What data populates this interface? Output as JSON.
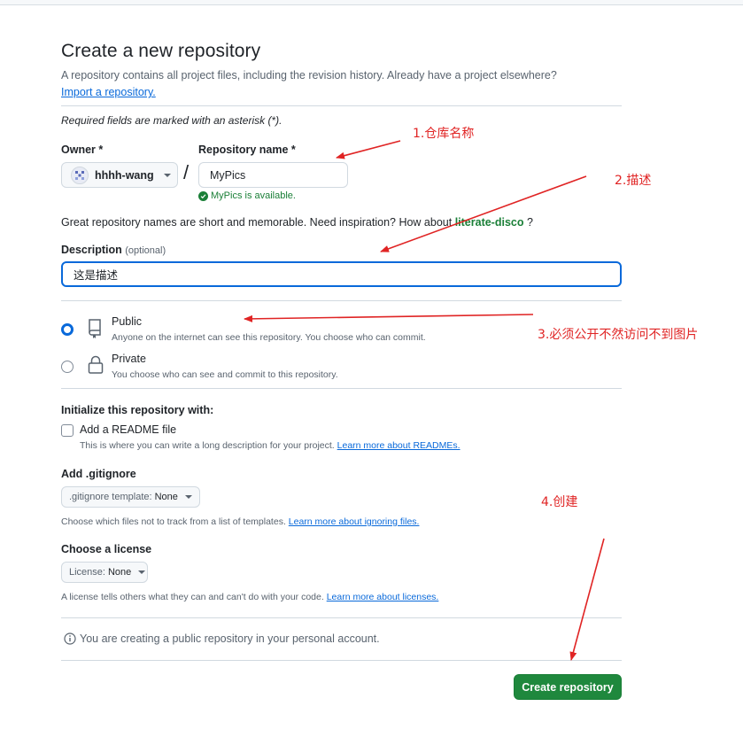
{
  "page": {
    "title": "Create a new repository",
    "subtitle": "A repository contains all project files, including the revision history. Already have a project elsewhere?",
    "import_link": "Import a repository.",
    "required_note": "Required fields are marked with an asterisk (*)."
  },
  "owner": {
    "label": "Owner *",
    "value": "hhhh-wang"
  },
  "repo_name": {
    "label": "Repository name *",
    "value": "MyPics",
    "availability": "MyPics is available."
  },
  "inspiration": {
    "text": "Great repository names are short and memorable. Need inspiration? How about",
    "suggestion": "literate-disco",
    "end": "?"
  },
  "description": {
    "label": "Description",
    "optional": "(optional)",
    "value": "这是描述"
  },
  "visibility": {
    "public_title": "Public",
    "public_desc": "Anyone on the internet can see this repository. You choose who can commit.",
    "public_selected": true,
    "private_title": "Private",
    "private_desc": "You choose who can see and commit to this repository."
  },
  "initialize": {
    "heading": "Initialize this repository with:",
    "readme_label": "Add a README file",
    "readme_checked": false,
    "readme_desc": "This is where you can write a long description for your project.",
    "readme_link": "Learn more about READMEs."
  },
  "gitignore": {
    "heading": "Add .gitignore",
    "dropdown_key": ".gitignore template:",
    "dropdown_value": "None",
    "desc": "Choose which files not to track from a list of templates.",
    "link": "Learn more about ignoring files."
  },
  "license": {
    "heading": "Choose a license",
    "dropdown_key": "License:",
    "dropdown_value": "None",
    "desc": "A license tells others what they can and can't do with your code.",
    "link": "Learn more about licenses."
  },
  "notice": "You are creating a public repository in your personal account.",
  "create_button": "Create repository",
  "annotations": {
    "a1": "1.仓库名称",
    "a2": "2.描述",
    "a3": "3.必须公开不然访问不到图片",
    "a4": "4.创建"
  },
  "colors": {
    "accent": "#0969da",
    "success": "#1a7f37",
    "primary_button": "#1f883d",
    "annotation": "#e02424"
  },
  "icons": [
    "owner-avatar-icon",
    "chevron-down-icon",
    "check-circle-icon",
    "repo-icon",
    "lock-icon",
    "info-icon"
  ]
}
